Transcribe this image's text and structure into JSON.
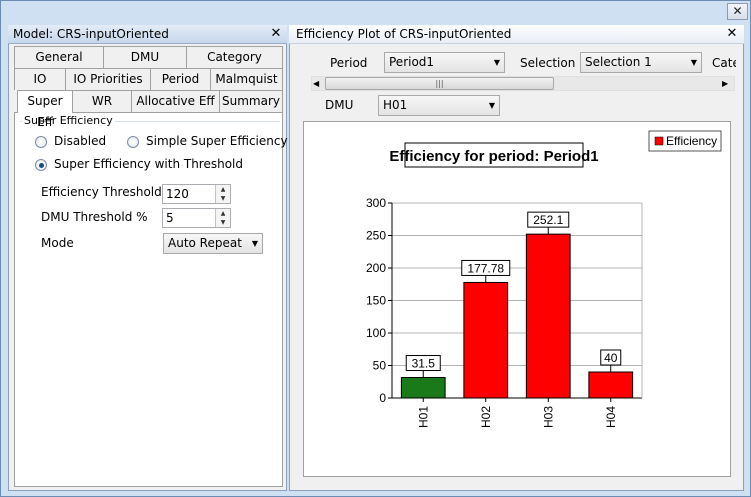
{
  "left_panel": {
    "title": "Model: CRS-inputOriented",
    "tabs_row1": [
      "General",
      "DMU",
      "Category"
    ],
    "tabs_row2": [
      "IO",
      "IO Priorities",
      "Period",
      "Malmquist"
    ],
    "tabs_row3": [
      "Super Eff",
      "WR",
      "Allocative Eff",
      "Summary"
    ],
    "active_tab": "Super Eff",
    "group_label": "Super Efficiency",
    "radio_disabled": "Disabled",
    "radio_simple": "Simple Super Efficiency",
    "radio_threshold": "Super Efficiency with Threshold",
    "selected_radio": "Super Efficiency with Threshold",
    "eff_threshold_label": "Efficiency Threshold %",
    "eff_threshold_value": "120",
    "dmu_threshold_label": "DMU Threshold %",
    "dmu_threshold_value": "5",
    "mode_label": "Mode",
    "mode_value": "Auto Repeat"
  },
  "right_panel": {
    "title": "Efficiency Plot of CRS-inputOriented",
    "period_label": "Period",
    "period_value": "Period1",
    "selection_label": "Selection",
    "selection_value": "Selection 1",
    "cate_label": "Cate",
    "dmu_label": "DMU",
    "dmu_value": "H01"
  },
  "icons": {
    "close": "close-icon",
    "dropdown": "chevron-down-icon",
    "scroll_left": "arrow-left-icon",
    "scroll_right": "arrow-right-icon",
    "spin_up": "spin-up-icon",
    "spin_down": "spin-down-icon"
  },
  "colors": {
    "efficient": "#1a7a1a",
    "inefficient": "#ff0000"
  },
  "chart_data": {
    "type": "bar",
    "title": "Efficiency for period: Period1",
    "categories": [
      "H01",
      "H02",
      "H03",
      "H04"
    ],
    "series": [
      {
        "name": "Efficiency",
        "values": [
          31.5,
          177.78,
          252.1,
          40
        ]
      }
    ],
    "bar_colors": [
      "#1a7a1a",
      "#ff0000",
      "#ff0000",
      "#ff0000"
    ],
    "data_labels": [
      "31.5",
      "177.78",
      "252.1",
      "40"
    ],
    "yticks": [
      "0",
      "50",
      "100",
      "150",
      "200",
      "250",
      "300"
    ],
    "ylim": [
      0,
      300
    ],
    "grid": true,
    "legend": "top-right",
    "xlabel": "",
    "ylabel": ""
  }
}
